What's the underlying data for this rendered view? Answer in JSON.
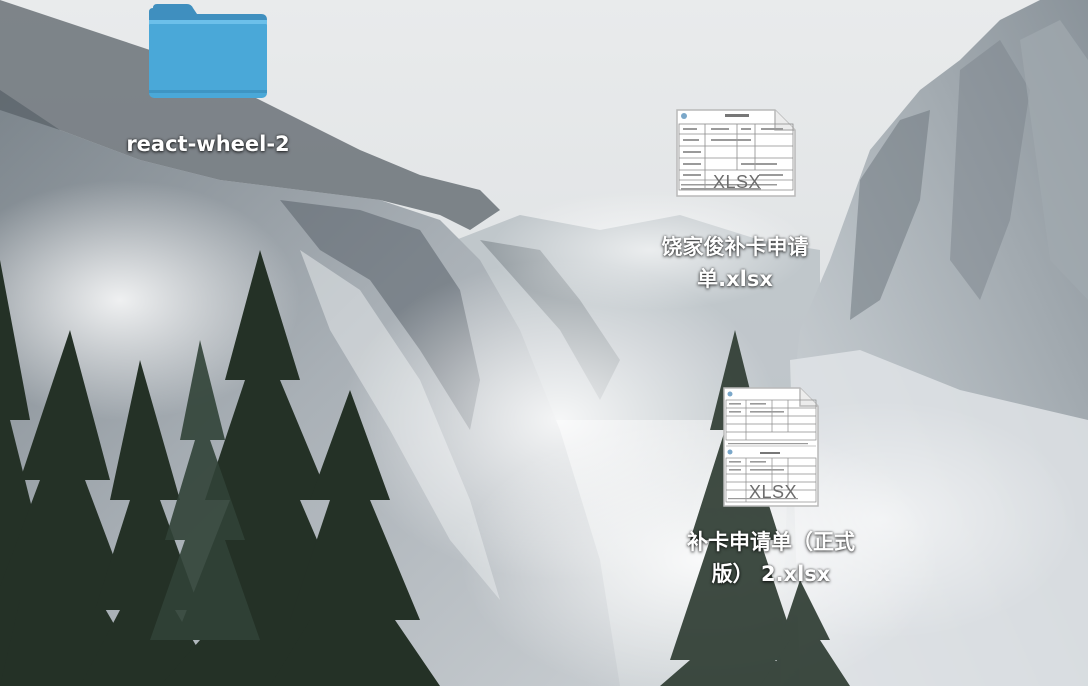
{
  "desktop": {
    "items": [
      {
        "kind": "folder",
        "label": "react-wheel-2",
        "icon": "folder-icon",
        "color": "#4aa8d8"
      },
      {
        "kind": "file",
        "label_lines": [
          "饶家俊补卡申请",
          "单.xlsx"
        ],
        "icon": "xlsx-file-icon",
        "type_mark": "XLSX"
      },
      {
        "kind": "file",
        "label_lines": [
          "补卡申请单（正式",
          "版） 2.xlsx"
        ],
        "icon": "xlsx-file-icon",
        "type_mark": "XLSX"
      }
    ]
  }
}
